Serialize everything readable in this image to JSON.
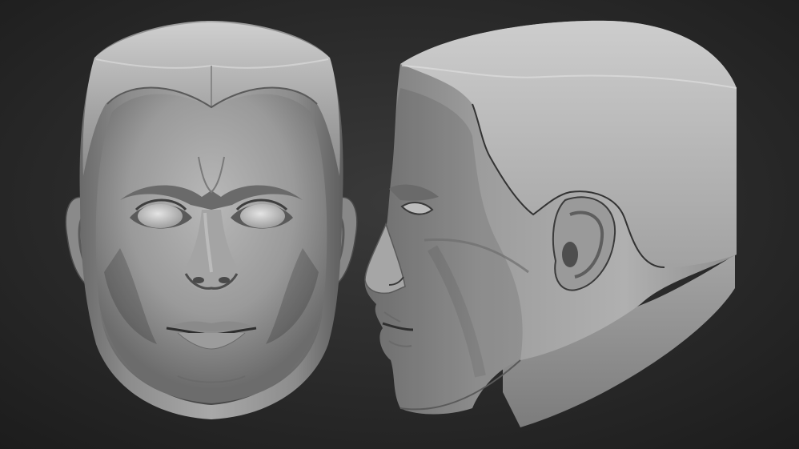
{
  "scene": {
    "subject": "head-sculpt",
    "views": [
      "front-view",
      "side-view"
    ],
    "colors": {
      "background_center": "#3a3a3a",
      "background_edge": "#1c1c1c",
      "clay_highlight": "#c8c8c8",
      "clay_mid": "#9a9a9a",
      "clay_shadow": "#3e3e3e",
      "crease": "#1e1e1e"
    }
  }
}
